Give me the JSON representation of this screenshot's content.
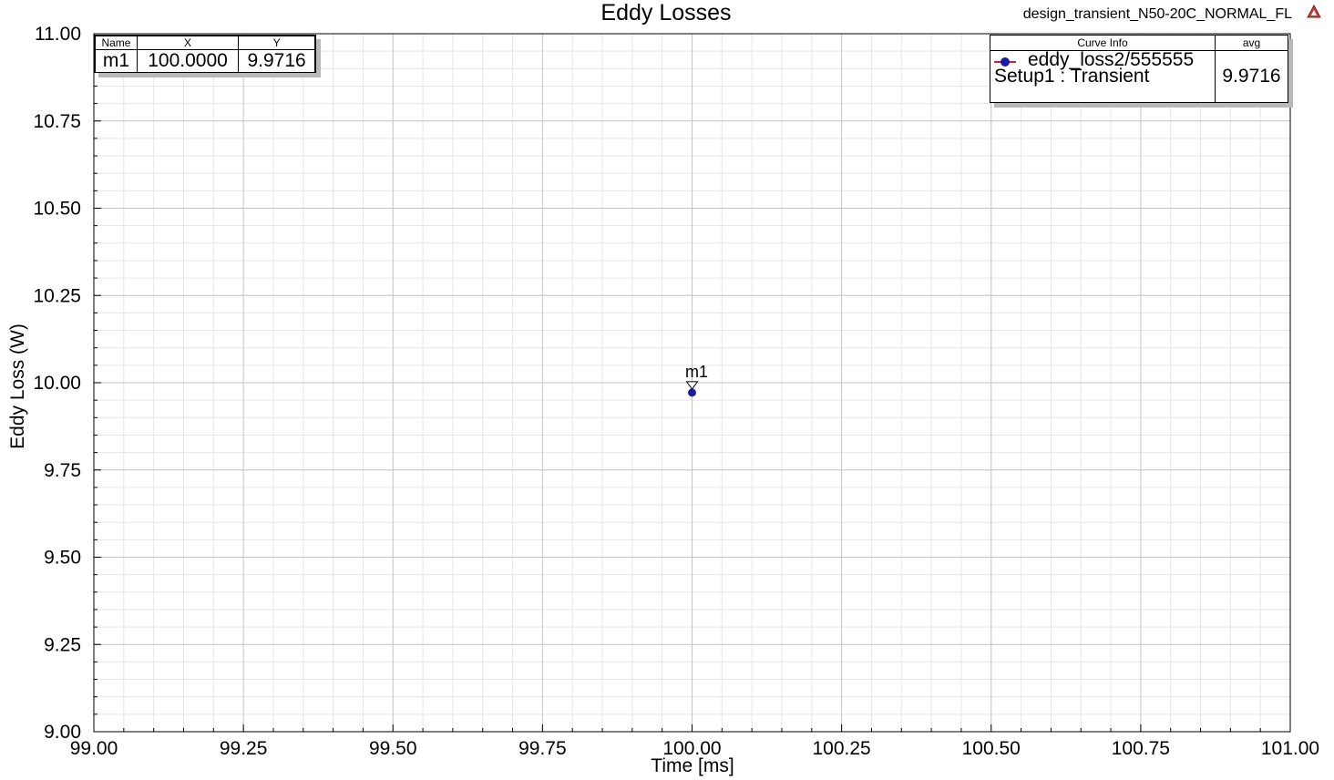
{
  "header": {
    "design_name": "design_transient_N50-20C_NORMAL_FL"
  },
  "colors": {
    "series": "#1a1aa8",
    "series_line": "#d42020",
    "grid_major": "#c4c4c4",
    "grid_minor": "#e6e6e6",
    "warning_icon": "#d04040"
  },
  "icons": {
    "warning": "warning-triangle-icon"
  },
  "chart_data": {
    "type": "scatter",
    "title": "Eddy Losses",
    "xlabel": "Time [ms]",
    "ylabel": "Eddy Loss (W)",
    "xlim": [
      99.0,
      101.0
    ],
    "ylim": [
      9.0,
      11.0
    ],
    "x_ticks": [
      "99.00",
      "99.25",
      "99.50",
      "99.75",
      "100.00",
      "100.25",
      "100.50",
      "100.75",
      "101.00"
    ],
    "y_ticks": [
      "9.00",
      "9.25",
      "9.50",
      "9.75",
      "10.00",
      "10.25",
      "10.50",
      "10.75",
      "11.00"
    ],
    "grid": true,
    "legend_placement": "top-right",
    "series": [
      {
        "name": "eddy_loss2/555555",
        "setup": "Setup1 : Transient",
        "points": [
          {
            "x": 100.0,
            "y": 9.9716
          }
        ]
      }
    ]
  },
  "marker_table": {
    "headers": [
      "Name",
      "X",
      "Y"
    ],
    "rows": [
      {
        "name": "m1",
        "x": "100.0000",
        "y": "9.9716"
      }
    ]
  },
  "marker": {
    "label": "m1",
    "x": 100.0,
    "y": 9.9716
  },
  "legend": {
    "header_curve": "Curve Info",
    "header_stat": "avg",
    "series_name": "eddy_loss2/555555",
    "setup": "Setup1 : Transient",
    "avg": "9.9716"
  }
}
